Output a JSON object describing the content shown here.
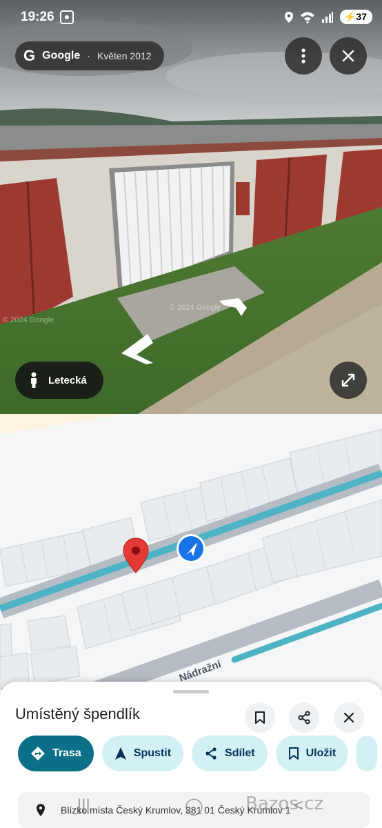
{
  "status_bar": {
    "time": "19:26",
    "battery": "37"
  },
  "street_view": {
    "provider": "Google",
    "capture_date": "Květen 2012",
    "view_toggle_label": "Letecká",
    "watermark": "© 2024 Google"
  },
  "map": {
    "street_label": "Nádražní"
  },
  "sheet": {
    "title": "Umístěný špendlík",
    "actions": [
      {
        "label": "Trasa"
      },
      {
        "label": "Spustit"
      },
      {
        "label": "Sdílet"
      },
      {
        "label": "Uložit"
      }
    ],
    "address": "Blízko místa Český Krumlov, 381 01 Český Krumlov 1"
  },
  "watermark_site": "Bazos.cz",
  "colors": {
    "accent": "#0b6f88",
    "chip_bg": "#d3f1f5",
    "road": "#4fb3c6",
    "pin": "#e53935",
    "location_dot": "#1a73e8"
  }
}
